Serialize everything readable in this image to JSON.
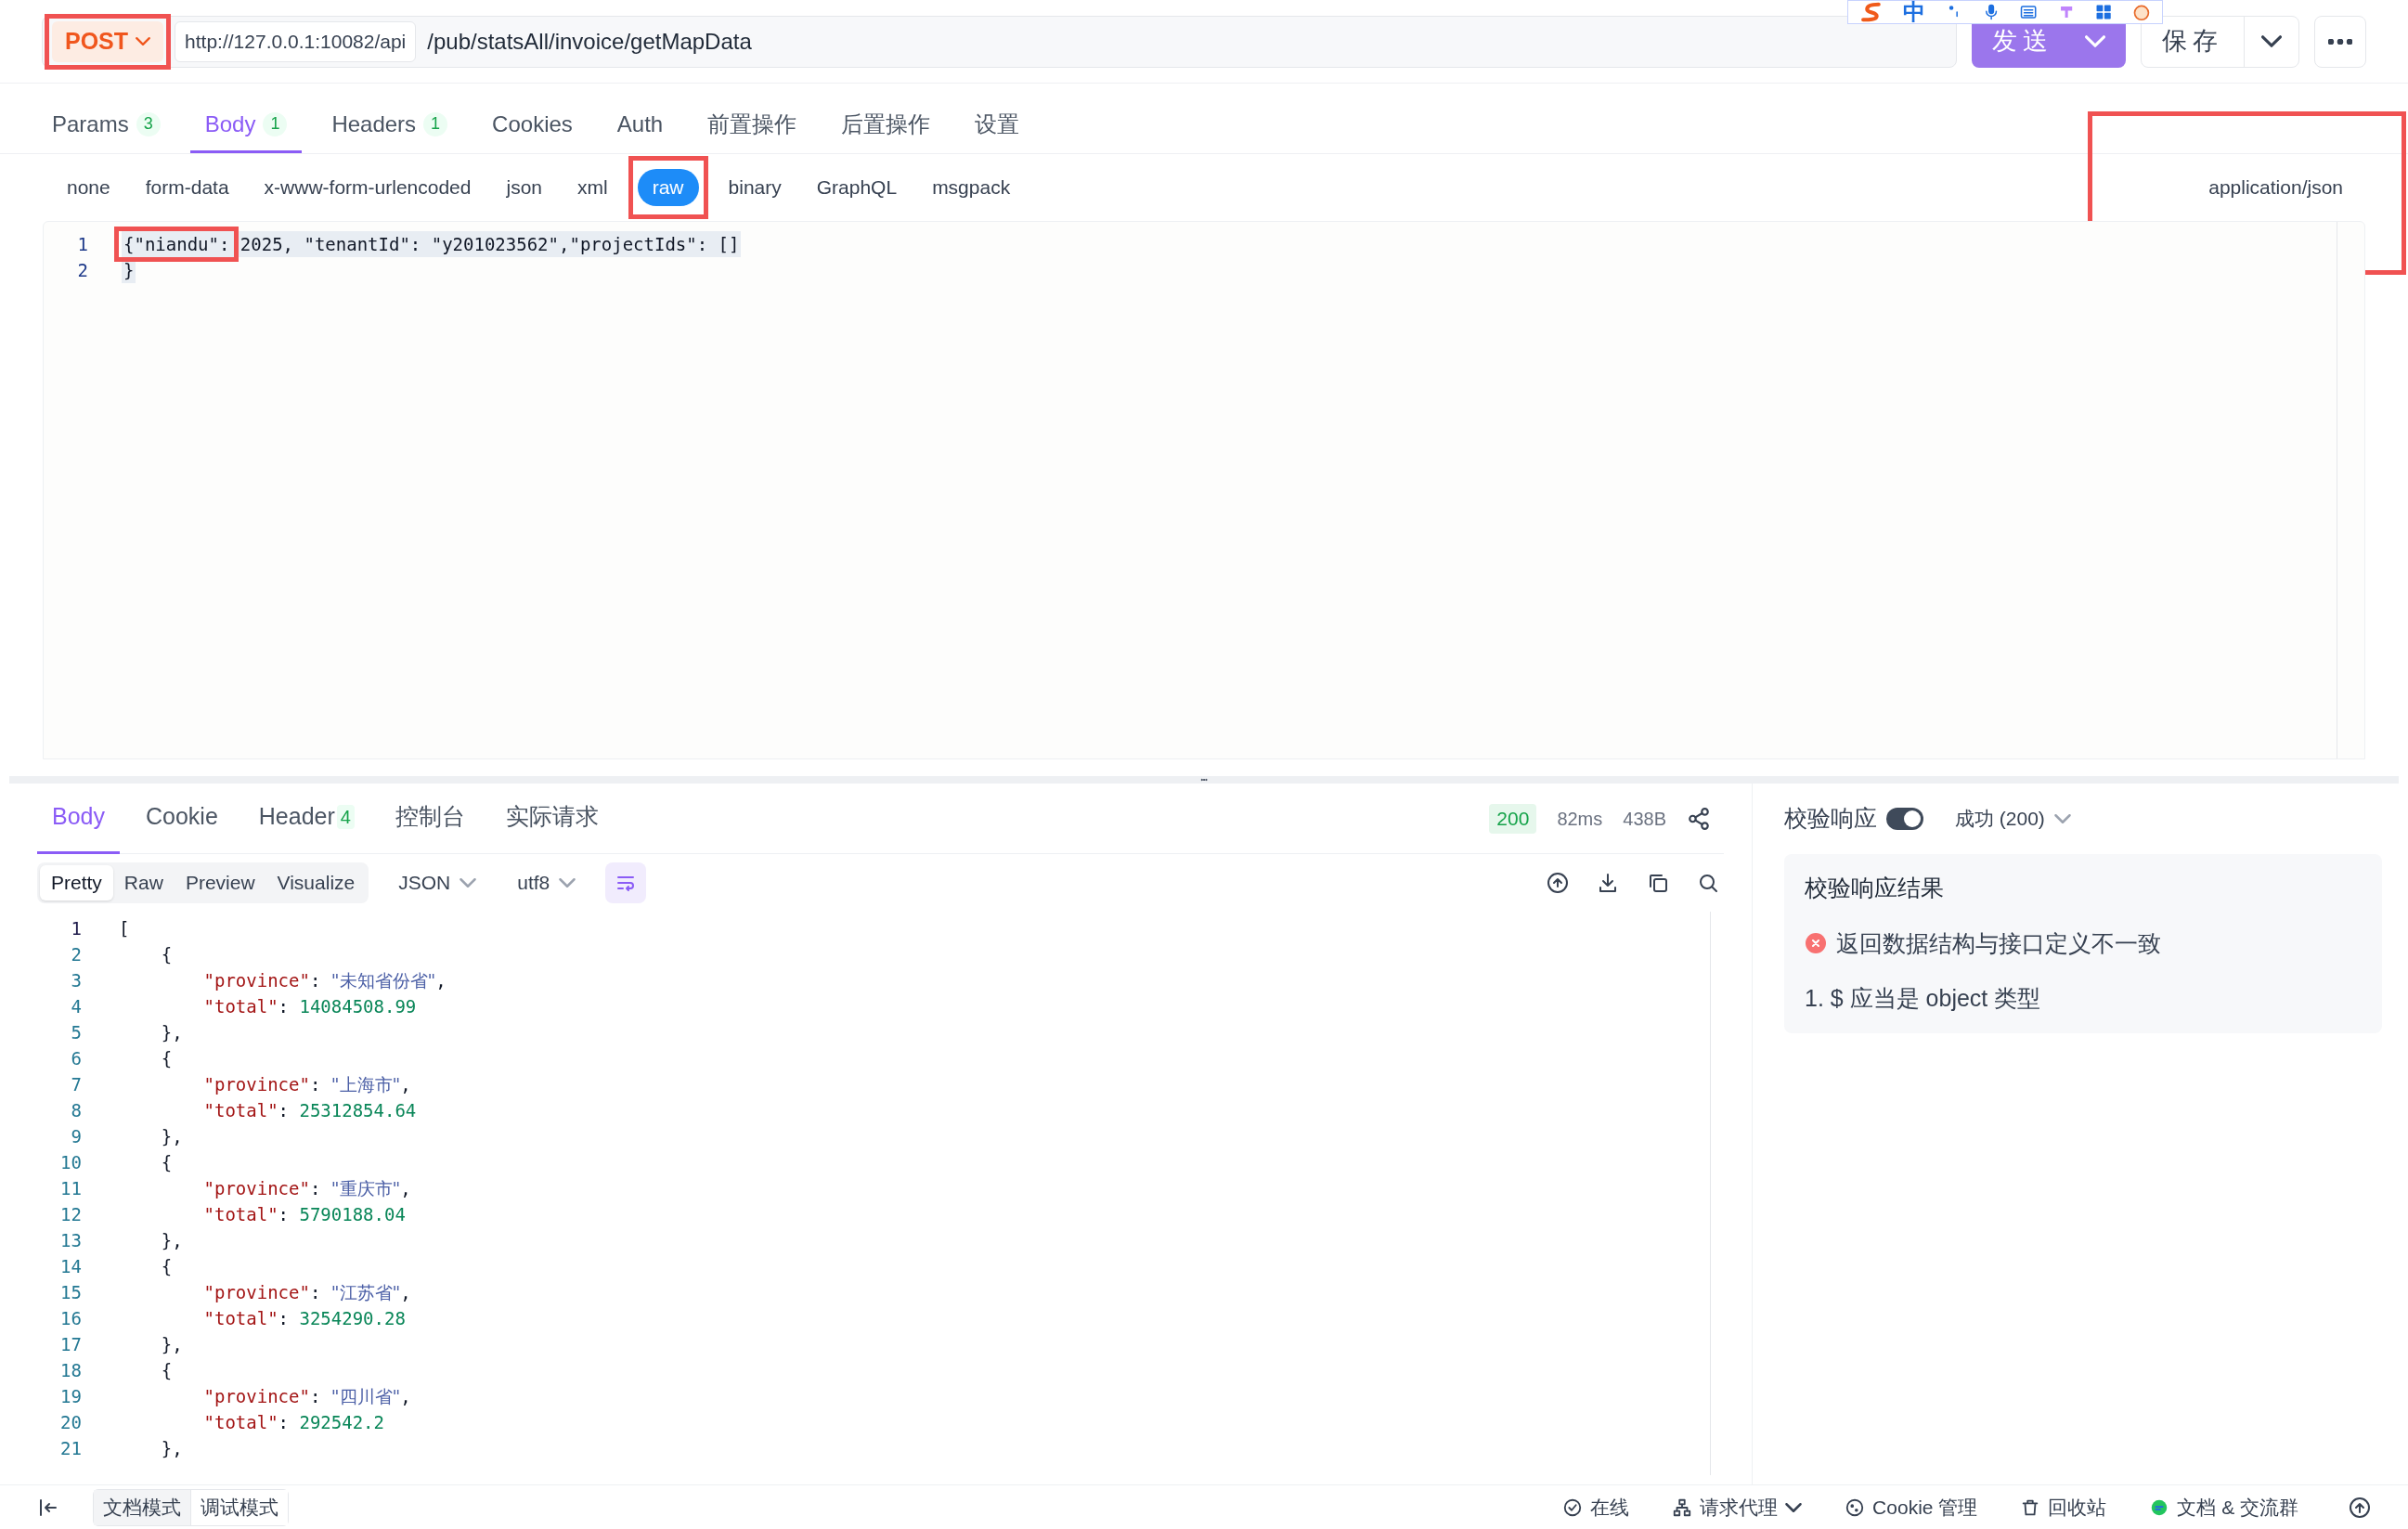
{
  "request": {
    "method": {
      "label": "POST",
      "highlighted": true
    },
    "base_url": "http://127.0.0.1:10082/api",
    "path": "/pub/statsAll/invoice/getMapData",
    "send_button": "发送",
    "save_button": "保存"
  },
  "ime_bar": {
    "label": "中"
  },
  "request_tabs": [
    {
      "label": "Params",
      "count": "3",
      "selected": false
    },
    {
      "label": "Body",
      "count": "1",
      "selected": true
    },
    {
      "label": "Headers",
      "count": "1",
      "selected": false
    },
    {
      "label": "Cookies",
      "selected": false
    },
    {
      "label": "Auth",
      "selected": false
    },
    {
      "label": "前置操作",
      "selected": false
    },
    {
      "label": "后置操作",
      "selected": false
    },
    {
      "label": "设置",
      "selected": false
    }
  ],
  "body_types": [
    {
      "label": "none",
      "selected": false,
      "highlighted": false
    },
    {
      "label": "form-data",
      "selected": false,
      "highlighted": false
    },
    {
      "label": "x-www-form-urlencoded",
      "selected": false,
      "highlighted": false
    },
    {
      "label": "json",
      "selected": false,
      "highlighted": false
    },
    {
      "label": "xml",
      "selected": false,
      "highlighted": false
    },
    {
      "label": "raw",
      "selected": true,
      "highlighted": true
    },
    {
      "label": "binary",
      "selected": false,
      "highlighted": false
    },
    {
      "label": "GraphQL",
      "selected": false,
      "highlighted": false
    },
    {
      "label": "msgpack",
      "selected": false,
      "highlighted": false
    }
  ],
  "content_type": {
    "label": "application/json",
    "highlighted": true
  },
  "request_body": [
    {
      "no": "1",
      "segments": [
        {
          "text": "{\"niandu\":",
          "highlighted": true
        },
        {
          "text": " 2025, \"tenantId\": \"y201023562\",\"projectIds\": []",
          "highlighted": false
        }
      ]
    },
    {
      "no": "2",
      "segments": [
        {
          "text": "}",
          "highlighted": false
        }
      ]
    }
  ],
  "response_tabs": [
    {
      "label": "Body",
      "selected": true
    },
    {
      "label": "Cookie",
      "selected": false
    },
    {
      "label": "Header",
      "count": "4",
      "selected": false
    },
    {
      "label": "控制台",
      "selected": false
    },
    {
      "label": "实际请求",
      "selected": false
    }
  ],
  "response_meta": {
    "status": "200",
    "time": "82ms",
    "size": "438B"
  },
  "view_modes": [
    {
      "label": "Pretty",
      "selected": true
    },
    {
      "label": "Raw",
      "selected": false
    },
    {
      "label": "Preview",
      "selected": false
    },
    {
      "label": "Visualize",
      "selected": false
    }
  ],
  "format_select": "JSON",
  "encoding_select": "utf8",
  "response_lines": [
    {
      "no": "1",
      "tokens": [
        {
          "kind": "punct",
          "text": "["
        }
      ]
    },
    {
      "no": "2",
      "tokens": [
        {
          "kind": "punct",
          "text": "    {"
        }
      ]
    },
    {
      "no": "3",
      "tokens": [
        {
          "kind": "key",
          "text": "        \"province\""
        },
        {
          "kind": "punct",
          "text": ": "
        },
        {
          "kind": "string",
          "text": "\"未知省份省\""
        },
        {
          "kind": "punct",
          "text": ","
        }
      ]
    },
    {
      "no": "4",
      "tokens": [
        {
          "kind": "key",
          "text": "        \"total\""
        },
        {
          "kind": "punct",
          "text": ": "
        },
        {
          "kind": "number",
          "text": "14084508.99"
        }
      ]
    },
    {
      "no": "5",
      "tokens": [
        {
          "kind": "punct",
          "text": "    },"
        }
      ]
    },
    {
      "no": "6",
      "tokens": [
        {
          "kind": "punct",
          "text": "    {"
        }
      ]
    },
    {
      "no": "7",
      "tokens": [
        {
          "kind": "key",
          "text": "        \"province\""
        },
        {
          "kind": "punct",
          "text": ": "
        },
        {
          "kind": "string",
          "text": "\"上海市\""
        },
        {
          "kind": "punct",
          "text": ","
        }
      ]
    },
    {
      "no": "8",
      "tokens": [
        {
          "kind": "key",
          "text": "        \"total\""
        },
        {
          "kind": "punct",
          "text": ": "
        },
        {
          "kind": "number",
          "text": "25312854.64"
        }
      ]
    },
    {
      "no": "9",
      "tokens": [
        {
          "kind": "punct",
          "text": "    },"
        }
      ]
    },
    {
      "no": "10",
      "tokens": [
        {
          "kind": "punct",
          "text": "    {"
        }
      ]
    },
    {
      "no": "11",
      "tokens": [
        {
          "kind": "key",
          "text": "        \"province\""
        },
        {
          "kind": "punct",
          "text": ": "
        },
        {
          "kind": "string",
          "text": "\"重庆市\""
        },
        {
          "kind": "punct",
          "text": ","
        }
      ]
    },
    {
      "no": "12",
      "tokens": [
        {
          "kind": "key",
          "text": "        \"total\""
        },
        {
          "kind": "punct",
          "text": ": "
        },
        {
          "kind": "number",
          "text": "5790188.04"
        }
      ]
    },
    {
      "no": "13",
      "tokens": [
        {
          "kind": "punct",
          "text": "    },"
        }
      ]
    },
    {
      "no": "14",
      "tokens": [
        {
          "kind": "punct",
          "text": "    {"
        }
      ]
    },
    {
      "no": "15",
      "tokens": [
        {
          "kind": "key",
          "text": "        \"province\""
        },
        {
          "kind": "punct",
          "text": ": "
        },
        {
          "kind": "string",
          "text": "\"江苏省\""
        },
        {
          "kind": "punct",
          "text": ","
        }
      ]
    },
    {
      "no": "16",
      "tokens": [
        {
          "kind": "key",
          "text": "        \"total\""
        },
        {
          "kind": "punct",
          "text": ": "
        },
        {
          "kind": "number",
          "text": "3254290.28"
        }
      ]
    },
    {
      "no": "17",
      "tokens": [
        {
          "kind": "punct",
          "text": "    },"
        }
      ]
    },
    {
      "no": "18",
      "tokens": [
        {
          "kind": "punct",
          "text": "    {"
        }
      ]
    },
    {
      "no": "19",
      "tokens": [
        {
          "kind": "key",
          "text": "        \"province\""
        },
        {
          "kind": "punct",
          "text": ": "
        },
        {
          "kind": "string",
          "text": "\"四川省\""
        },
        {
          "kind": "punct",
          "text": ","
        }
      ]
    },
    {
      "no": "20",
      "tokens": [
        {
          "kind": "key",
          "text": "        \"total\""
        },
        {
          "kind": "punct",
          "text": ": "
        },
        {
          "kind": "number",
          "text": "292542.2"
        }
      ]
    },
    {
      "no": "21",
      "tokens": [
        {
          "kind": "punct",
          "text": "    },"
        }
      ]
    }
  ],
  "validation": {
    "label": "校验响应",
    "on": true,
    "result_select": "成功 (200)",
    "panel_title": "校验响应结果",
    "error": "返回数据结构与接口定义不一致",
    "detail": "1. $ 应当是 object 类型"
  },
  "bottom_bar": {
    "modes": [
      {
        "label": "文档模式",
        "selected": false
      },
      {
        "label": "调试模式",
        "selected": true
      }
    ],
    "items": [
      {
        "kind": "online",
        "label": "在线"
      },
      {
        "kind": "proxy",
        "label": "请求代理"
      },
      {
        "kind": "cookie",
        "label": "Cookie 管理"
      },
      {
        "kind": "trash",
        "label": "回收站"
      },
      {
        "kind": "chat",
        "label": "文档 & 交流群"
      }
    ]
  }
}
